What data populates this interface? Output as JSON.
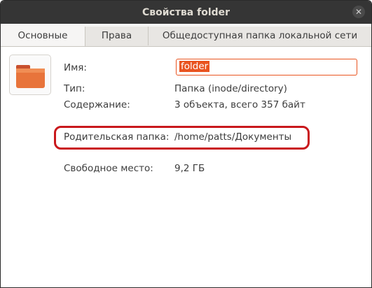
{
  "window": {
    "title": "Свойства folder"
  },
  "tabs": [
    {
      "label": "Основные"
    },
    {
      "label": "Права"
    },
    {
      "label": "Общедоступная папка локальной сети"
    }
  ],
  "general": {
    "name_label": "Имя:",
    "name_value": "folder",
    "type_label": "Тип:",
    "type_value": "Папка (inode/directory)",
    "contents_label": "Содержание:",
    "contents_value": "3 объекта, всего 357 байт",
    "parent_label": "Родительская папка:",
    "parent_value": "/home/patts/Документы",
    "free_label": "Свободное место:",
    "free_value": "9,2 ГБ"
  },
  "icons": {
    "close": "close-icon",
    "folder": "folder-icon"
  },
  "colors": {
    "accent": "#e95420",
    "highlight": "#c9181c",
    "titlebar": "#353535"
  }
}
